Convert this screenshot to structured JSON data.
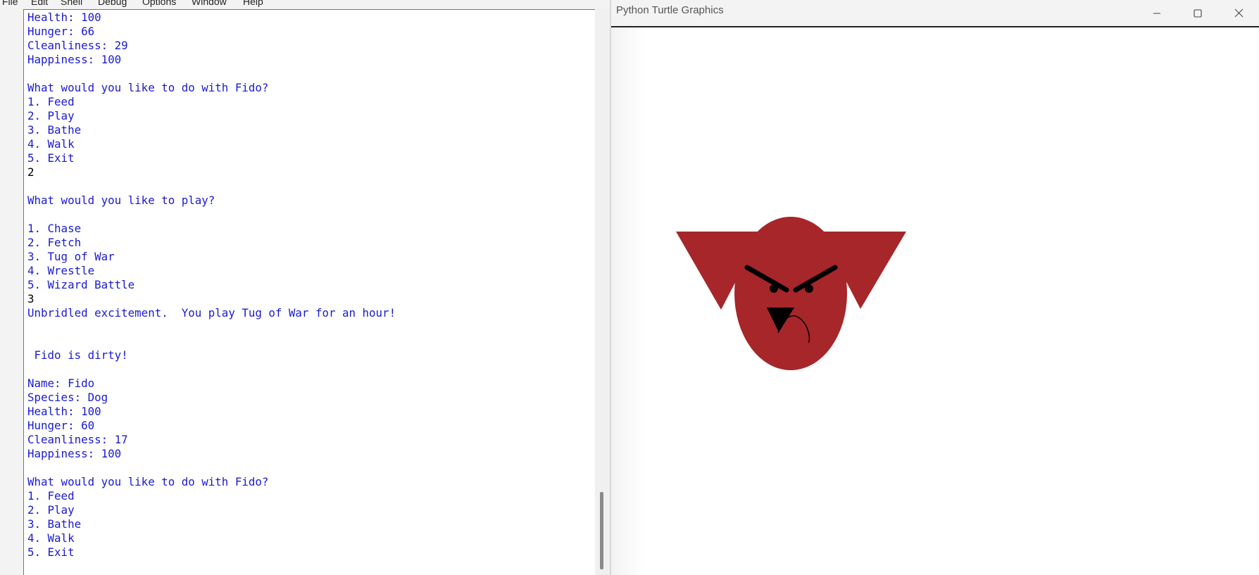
{
  "shell": {
    "menu": [
      "File",
      "Edit",
      "Shell",
      "Debug",
      "Options",
      "Window",
      "Help"
    ],
    "lines": [
      {
        "text": "Health: 100",
        "kind": "out"
      },
      {
        "text": "Hunger: 66",
        "kind": "out"
      },
      {
        "text": "Cleanliness: 29",
        "kind": "out"
      },
      {
        "text": "Happiness: 100",
        "kind": "out"
      },
      {
        "text": "",
        "kind": "out"
      },
      {
        "text": "What would you like to do with Fido?",
        "kind": "out"
      },
      {
        "text": "1. Feed",
        "kind": "out"
      },
      {
        "text": "2. Play",
        "kind": "out"
      },
      {
        "text": "3. Bathe",
        "kind": "out"
      },
      {
        "text": "4. Walk",
        "kind": "out"
      },
      {
        "text": "5. Exit",
        "kind": "out"
      },
      {
        "text": "2",
        "kind": "inp"
      },
      {
        "text": "",
        "kind": "out"
      },
      {
        "text": "What would you like to play?",
        "kind": "out"
      },
      {
        "text": "",
        "kind": "out"
      },
      {
        "text": "1. Chase",
        "kind": "out"
      },
      {
        "text": "2. Fetch",
        "kind": "out"
      },
      {
        "text": "3. Tug of War",
        "kind": "out"
      },
      {
        "text": "4. Wrestle",
        "kind": "out"
      },
      {
        "text": "5. Wizard Battle",
        "kind": "out"
      },
      {
        "text": "3",
        "kind": "inp"
      },
      {
        "text": "Unbridled excitement.  You play Tug of War for an hour!",
        "kind": "out"
      },
      {
        "text": "",
        "kind": "out"
      },
      {
        "text": "",
        "kind": "out"
      },
      {
        "text": " Fido is dirty!",
        "kind": "out"
      },
      {
        "text": "",
        "kind": "out"
      },
      {
        "text": "Name: Fido",
        "kind": "out"
      },
      {
        "text": "Species: Dog",
        "kind": "out"
      },
      {
        "text": "Health: 100",
        "kind": "out"
      },
      {
        "text": "Hunger: 60",
        "kind": "out"
      },
      {
        "text": "Cleanliness: 17",
        "kind": "out"
      },
      {
        "text": "Happiness: 100",
        "kind": "out"
      },
      {
        "text": "",
        "kind": "out"
      },
      {
        "text": "What would you like to do with Fido?",
        "kind": "out"
      },
      {
        "text": "1. Feed",
        "kind": "out"
      },
      {
        "text": "2. Play",
        "kind": "out"
      },
      {
        "text": "3. Bathe",
        "kind": "out"
      },
      {
        "text": "4. Walk",
        "kind": "out"
      },
      {
        "text": "5. Exit",
        "kind": "out"
      }
    ]
  },
  "turtle": {
    "title": "Python Turtle Graphics",
    "buttons": {
      "minimize": "minimize-icon",
      "maximize": "maximize-icon",
      "close": "close-icon"
    },
    "drawing": {
      "face_color": "#a6262a",
      "feature_color": "#000000"
    }
  }
}
